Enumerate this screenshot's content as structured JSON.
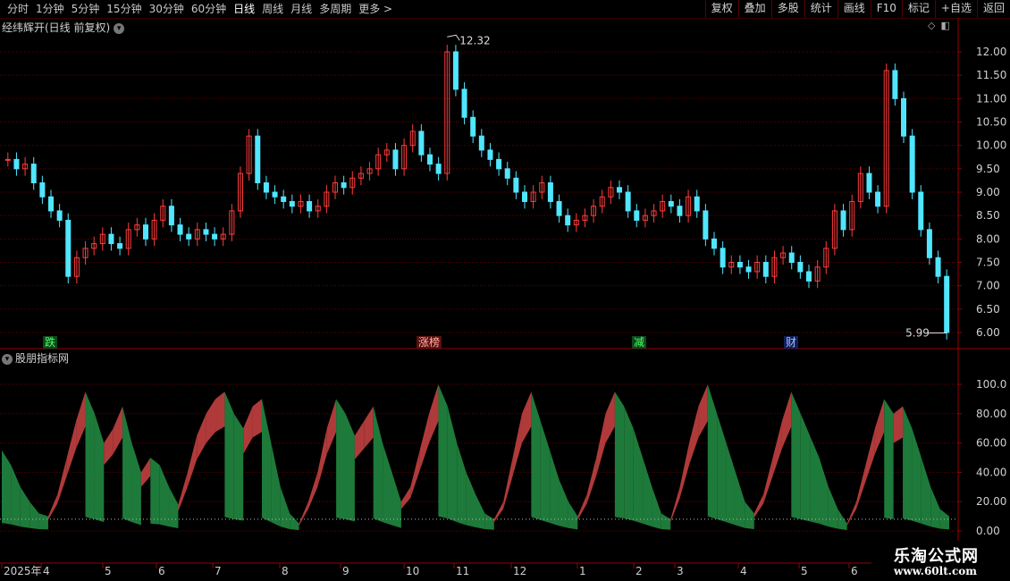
{
  "toolbar": {
    "periods": [
      "分时",
      "1分钟",
      "5分钟",
      "15分钟",
      "30分钟",
      "60分钟",
      "日线",
      "周线",
      "月线",
      "多周期",
      "更多 >"
    ],
    "active_period": "日线",
    "tools": [
      "复权",
      "叠加",
      "多股",
      "统计",
      "画线",
      "F10",
      "标记",
      "+自选",
      "返回"
    ]
  },
  "main_chart": {
    "title": "经纬辉开(日线 前复权)",
    "high_label": "12.32",
    "low_label": "5.99",
    "y_ticks": [
      "12.00",
      "11.50",
      "11.00",
      "10.50",
      "10.00",
      "9.50",
      "9.00",
      "8.50",
      "8.00",
      "7.50",
      "7.00",
      "6.50",
      "6.00"
    ],
    "tags": [
      {
        "text": "跌",
        "kind": "green"
      },
      {
        "text": "涨榜",
        "kind": "red"
      },
      {
        "text": "减",
        "kind": "green"
      },
      {
        "text": "财",
        "kind": "blue"
      }
    ]
  },
  "indicator": {
    "title": "股朋指标网",
    "y_ticks": [
      "100.0",
      "80.00",
      "60.00",
      "40.00",
      "20.00",
      "0.00"
    ]
  },
  "time_axis": {
    "labels": [
      "2025年",
      "4",
      "5",
      "6",
      "7",
      "8",
      "9",
      "10",
      "11",
      "12",
      "1",
      "2",
      "3",
      "4",
      "5",
      "6"
    ]
  },
  "watermark": {
    "line1": "乐淘公式网",
    "line2": "www.60lt.com"
  },
  "colors": {
    "up": "#ff3c3c",
    "down": "#50e6ff",
    "red_fill": "#b03a3a",
    "green_fill": "#1e7a3a",
    "grid": "#6a0000",
    "axis": "#9a0000"
  },
  "chart_data": {
    "type": "candlestick",
    "price_range": [
      6.0,
      12.32
    ],
    "indicator_range": [
      0,
      100
    ],
    "close_series": [
      9.7,
      9.5,
      9.6,
      9.2,
      8.9,
      8.6,
      8.4,
      7.2,
      7.6,
      7.8,
      7.9,
      8.1,
      7.9,
      7.8,
      8.2,
      8.3,
      8.0,
      8.4,
      8.7,
      8.3,
      8.1,
      8.0,
      8.2,
      8.1,
      8.0,
      8.1,
      8.6,
      9.4,
      10.2,
      9.2,
      9.0,
      8.9,
      8.8,
      8.7,
      8.8,
      8.6,
      8.7,
      9.0,
      9.2,
      9.1,
      9.3,
      9.4,
      9.5,
      9.8,
      9.9,
      9.5,
      10.0,
      10.3,
      9.8,
      9.6,
      9.4,
      12.0,
      11.2,
      10.6,
      10.2,
      9.9,
      9.7,
      9.5,
      9.3,
      9.0,
      8.8,
      9.0,
      9.2,
      8.8,
      8.5,
      8.3,
      8.4,
      8.5,
      8.7,
      8.9,
      9.1,
      9.0,
      8.6,
      8.4,
      8.5,
      8.6,
      8.8,
      8.7,
      8.5,
      8.9,
      8.6,
      8.0,
      7.8,
      7.4,
      7.5,
      7.4,
      7.3,
      7.5,
      7.2,
      7.6,
      7.7,
      7.5,
      7.3,
      7.1,
      7.4,
      7.8,
      8.6,
      8.2,
      8.8,
      9.4,
      9.0,
      8.7,
      11.6,
      11.0,
      10.2,
      9.0,
      8.2,
      7.6,
      7.2,
      6.0
    ],
    "indicator_series": [
      55,
      45,
      30,
      20,
      12,
      10,
      25,
      50,
      75,
      95,
      80,
      60,
      70,
      85,
      60,
      40,
      50,
      45,
      30,
      18,
      40,
      65,
      80,
      90,
      95,
      80,
      70,
      85,
      90,
      60,
      30,
      12,
      5,
      20,
      40,
      70,
      90,
      80,
      65,
      75,
      85,
      60,
      40,
      20,
      30,
      55,
      80,
      100,
      85,
      60,
      40,
      25,
      12,
      8,
      20,
      50,
      80,
      95,
      75,
      55,
      35,
      20,
      10,
      25,
      50,
      80,
      95,
      85,
      70,
      50,
      30,
      12,
      8,
      30,
      60,
      85,
      100,
      80,
      60,
      40,
      20,
      12,
      25,
      50,
      75,
      95,
      80,
      65,
      50,
      30,
      15,
      5,
      20,
      45,
      70,
      90,
      80,
      85,
      70,
      50,
      30,
      15,
      10
    ]
  }
}
